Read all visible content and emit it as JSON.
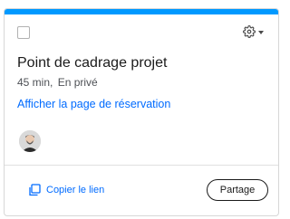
{
  "card": {
    "accent_color": "#0099ff",
    "title": "Point de cadrage projet",
    "duration": "45 min,",
    "privacy": "En privé",
    "view_link_label": "Afficher la page de réservation",
    "settings_icon": "gear-icon",
    "copy_link_label": "Copier le lien",
    "copy_icon": "copy-icon",
    "share_label": "Partage",
    "link_color": "#006bff"
  }
}
